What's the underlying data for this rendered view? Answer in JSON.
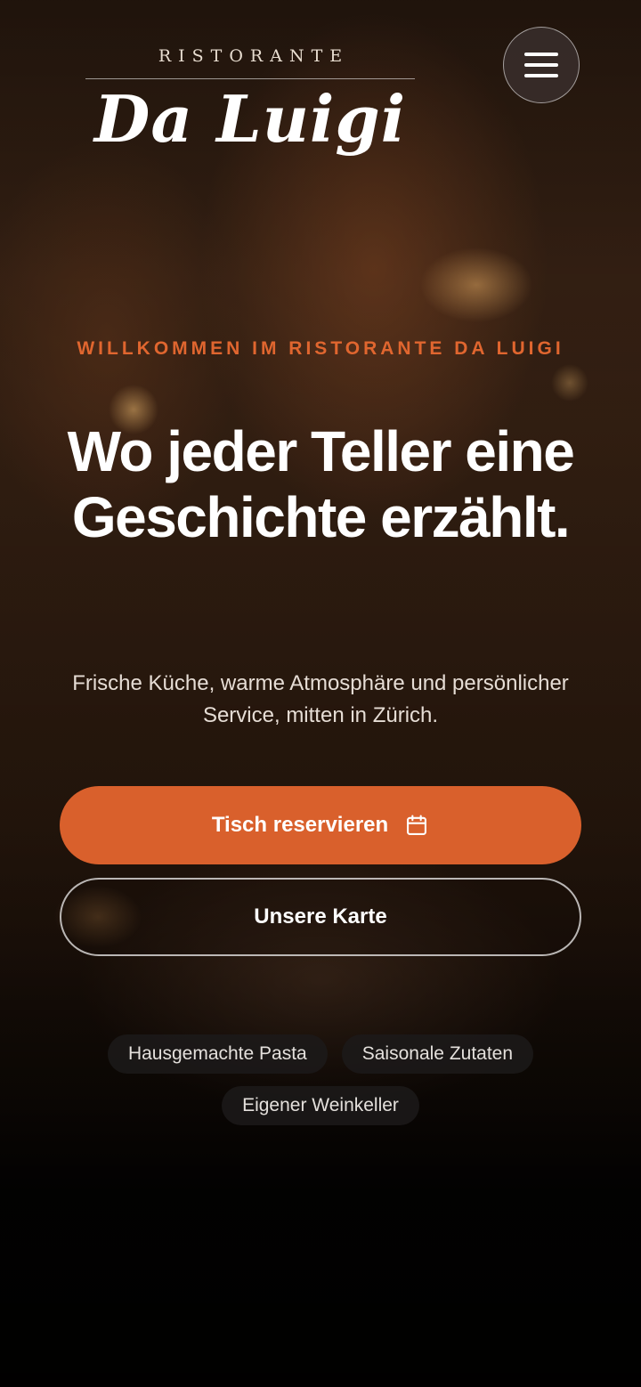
{
  "header": {
    "logo_subtitle": "RISTORANTE",
    "logo_name": "Da Luigi",
    "menu_icon": "hamburger-menu-icon"
  },
  "hero": {
    "eyebrow": "WILLKOMMEN IM RISTORANTE DA LUIGI",
    "headline": "Wo jeder Teller eine Geschichte erzählt.",
    "subtext": "Frische Küche, warme Atmosphäre und persönlicher Service, mitten in Zürich."
  },
  "actions": {
    "reserve_label": "Tisch reservieren",
    "reserve_icon": "calendar-icon",
    "menu_label": "Unsere Karte"
  },
  "chips": [
    {
      "label": "Hausgemachte Pasta"
    },
    {
      "label": "Saisonale Zutaten"
    },
    {
      "label": "Eigener Weinkeller"
    }
  ],
  "colors": {
    "accent": "#d9602c",
    "eyebrow": "#e0662f",
    "background": "#050302"
  }
}
